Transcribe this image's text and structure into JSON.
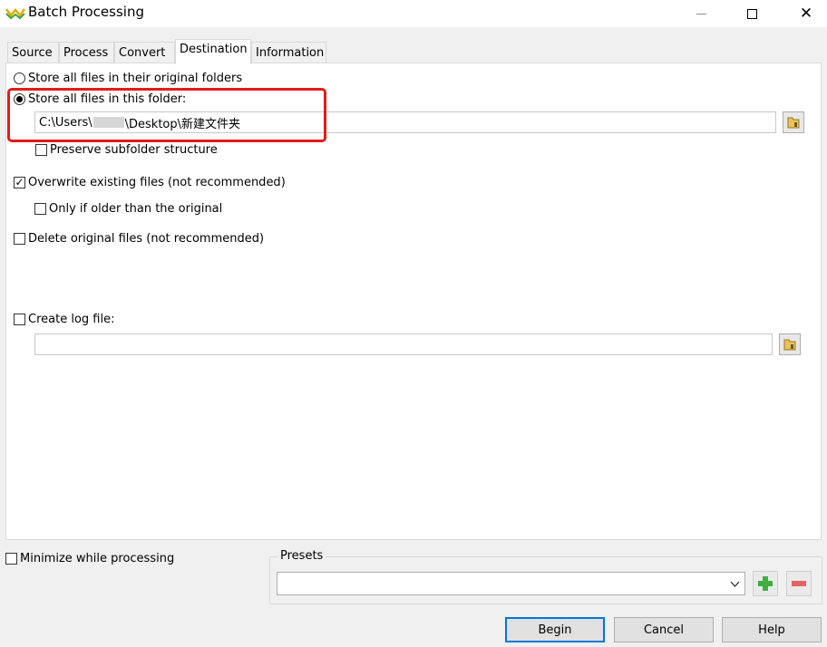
{
  "window": {
    "title": "Batch Processing",
    "close_glyph": "✕"
  },
  "tabs": [
    {
      "label": "Source"
    },
    {
      "label": "Process"
    },
    {
      "label": "Convert"
    },
    {
      "label": "Destination",
      "active": true
    },
    {
      "label": "Information"
    }
  ],
  "destination": {
    "option_original": "Store all files in their original folders",
    "option_folder": "Store all files in this folder:",
    "selected": "option_folder",
    "folder_path_prefix": "C:\\Users\\",
    "folder_path_suffix": "\\Desktop\\新建文件夹",
    "preserve_subfolder": {
      "label": "Preserve subfolder structure",
      "checked": false
    },
    "overwrite": {
      "label": "Overwrite existing files (not recommended)",
      "checked": true,
      "mark": "✓"
    },
    "only_if_older": {
      "label": "Only if older than the original",
      "checked": false
    },
    "delete_original": {
      "label": "Delete original files (not recommended)",
      "checked": false
    },
    "create_log": {
      "label": "Create log file:",
      "checked": false
    },
    "log_path": ""
  },
  "footer": {
    "minimize": {
      "label": "Minimize while processing",
      "checked": false
    },
    "presets_label": "Presets",
    "presets_value": "",
    "begin_label": "Begin",
    "cancel_label": "Cancel",
    "help_label": "Help"
  },
  "icons": {
    "app": "batch-icon",
    "folder": "folder-icon",
    "add": "plus-icon",
    "remove": "minus-icon",
    "dropdown": "chevron-down-icon"
  },
  "colors": {
    "highlight": "#e21b1b",
    "primary_border": "#0078d7",
    "add_green": "#3fae3f",
    "remove_red": "#e06666"
  }
}
